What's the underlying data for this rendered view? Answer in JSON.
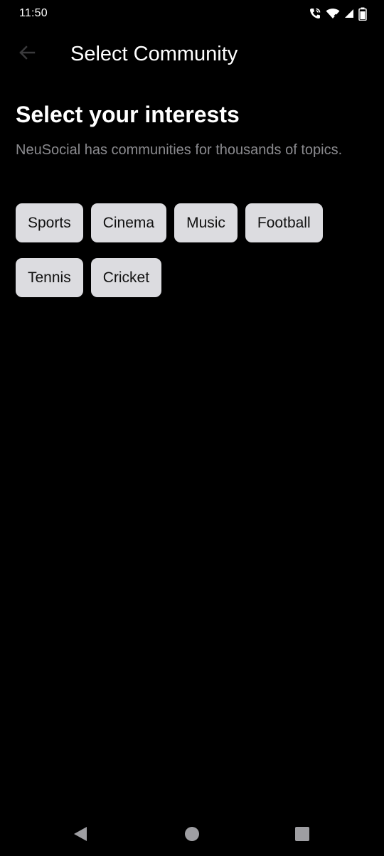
{
  "status_bar": {
    "time": "11:50",
    "icons": [
      "wifi-calling-icon",
      "wifi-icon",
      "cellular-signal-icon",
      "battery-icon"
    ]
  },
  "app_bar": {
    "title": "Select Community",
    "back_icon": "arrow-left-icon"
  },
  "main": {
    "heading": "Select your interests",
    "subtitle": "NeuSocial has communities for thousands of topics.",
    "chips": [
      {
        "label": "Sports"
      },
      {
        "label": "Cinema"
      },
      {
        "label": "Music"
      },
      {
        "label": "Football"
      },
      {
        "label": "Tennis"
      },
      {
        "label": "Cricket"
      }
    ]
  },
  "nav_bar": {
    "buttons": [
      "back-triangle-icon",
      "home-circle-icon",
      "recents-square-icon"
    ]
  },
  "colors": {
    "background": "#000000",
    "chip_background": "#dcdce0",
    "chip_text": "#111111",
    "subtitle_text": "#8a8a8e",
    "back_arrow": "#3a3a3c",
    "nav_icons": "#9e9ea2"
  }
}
